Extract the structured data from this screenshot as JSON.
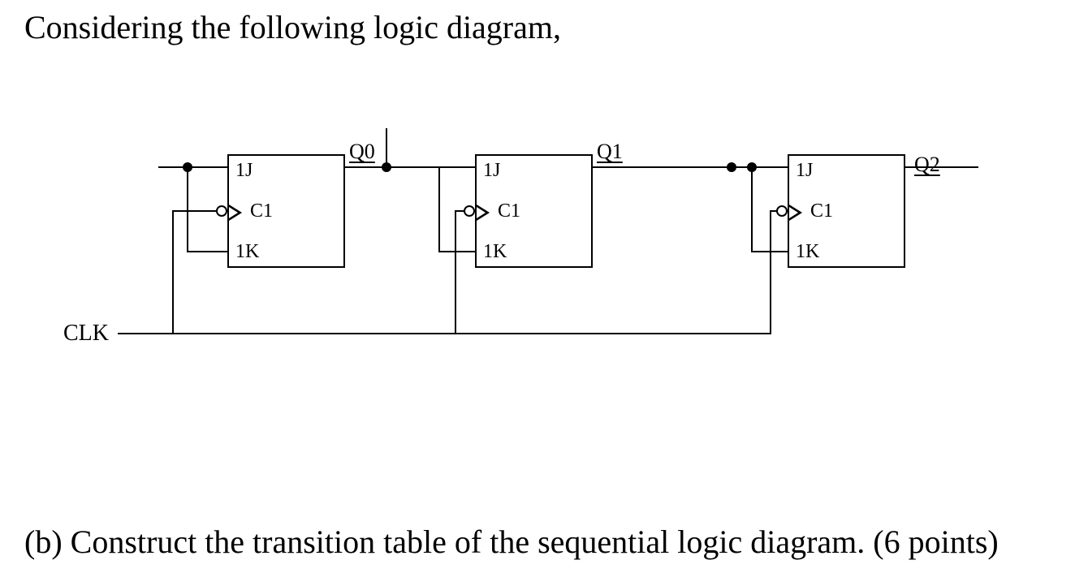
{
  "heading": "Considering the following logic diagram,",
  "question": "(b) Construct the transition table of the sequential logic diagram. (6 points)",
  "clk_label": "CLK",
  "outputs": {
    "q0": "Q0",
    "q1": "Q1",
    "q2": "Q2"
  },
  "ff_pins": {
    "j": "1J",
    "c": "C1",
    "k": "1K"
  },
  "diagram_description": {
    "type": "sequential_logic",
    "flipflops": [
      {
        "id": "FF0",
        "type": "JK",
        "clock_edge": "negative",
        "J_input": "Q0",
        "K_input": "Q0",
        "clock": "CLK",
        "output": "Q0"
      },
      {
        "id": "FF1",
        "type": "JK",
        "clock_edge": "negative",
        "J_input": "Q0",
        "K_input": "Q0",
        "clock": "CLK",
        "output": "Q1"
      },
      {
        "id": "FF2",
        "type": "JK",
        "clock_edge": "negative",
        "J_input": "Q1",
        "K_input": "Q1",
        "clock": "CLK",
        "output": "Q2"
      }
    ],
    "external_signals": [
      "CLK"
    ],
    "outputs": [
      "Q0",
      "Q1",
      "Q2"
    ]
  }
}
